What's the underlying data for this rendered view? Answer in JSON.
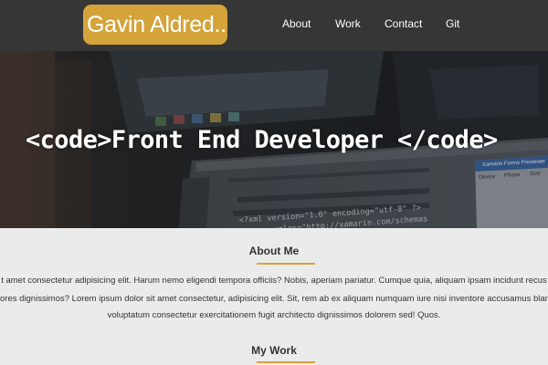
{
  "header": {
    "logo_text": "Gavin Aldred..",
    "nav": [
      {
        "label": "About"
      },
      {
        "label": "Work"
      },
      {
        "label": "Contact"
      },
      {
        "label": "Git"
      }
    ]
  },
  "hero": {
    "title": "<code>Front End Developer </code>",
    "code_snippet": {
      "line1": "<?xml version=\"1.0\" encoding=\"utf-8\" ?>",
      "line2": "xmlns=\"http://xamarin.com/schemas",
      "panel_title": "Xamarin.Forms Previewer",
      "panel_tab1": "Device",
      "panel_tab2": "Phone",
      "panel_tab3": "Size"
    }
  },
  "about": {
    "heading": "About Me",
    "line1": "t amet consectetur adipisicing elit. Harum nemo eligendi tempora officiis? Nobis, aperiam pariatur. Cumque quia, aliquam ipsam incidunt recus",
    "line2": "ores dignissimos? Lorem ipsum dolor sit amet consectetur, adipisicing elit. Sit, rem ab ex aliquam numquam iure nisi inventore accusamus blan",
    "line3": "voluptatum consectetur exercitationem fugit architecto dignissimos dolorem sed! Quos."
  },
  "work": {
    "heading": "My Work"
  },
  "colors": {
    "accent": "#d4a43a",
    "navbar": "#363636",
    "page_background": "#ebebeb"
  }
}
